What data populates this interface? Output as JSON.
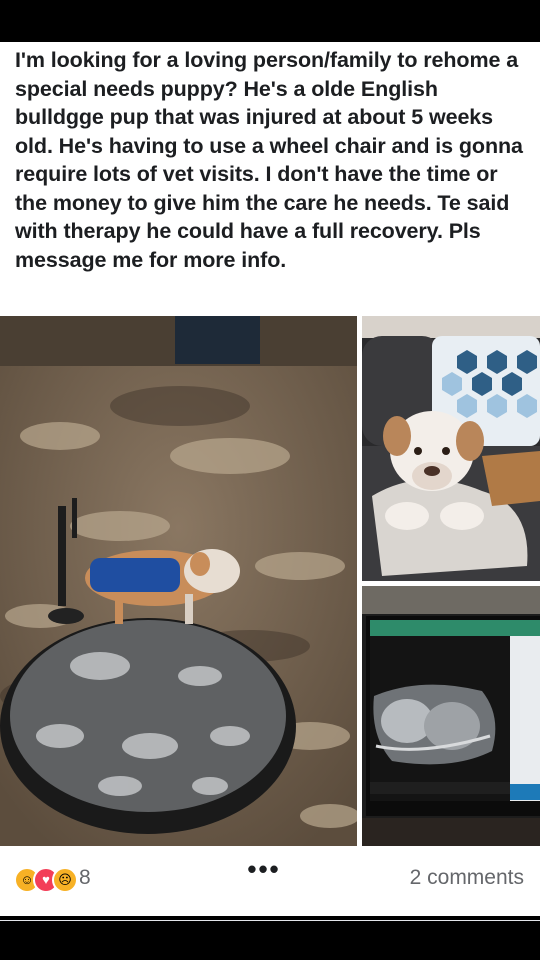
{
  "post": {
    "text": "I'm looking for a loving person/family to rehome a special needs puppy? He's a olde English bulldgge pup that was injured at about 5 weeks old. He's having to use a wheel chair and is gonna require lots of vet visits. I don't have the time or the money to give him the care he needs.  Te said with therapy he could have a full recovery. Pls message me for more info."
  },
  "photos": [
    {
      "icon": "puppy-wheelchair-photo"
    },
    {
      "icon": "puppy-on-couch-photo"
    },
    {
      "icon": "xray-monitor-photo"
    }
  ],
  "reactions": {
    "icons": [
      "care-icon",
      "love-icon",
      "sad-icon"
    ],
    "count": "8",
    "comments_label": "2 comments"
  },
  "more_label": "•••"
}
